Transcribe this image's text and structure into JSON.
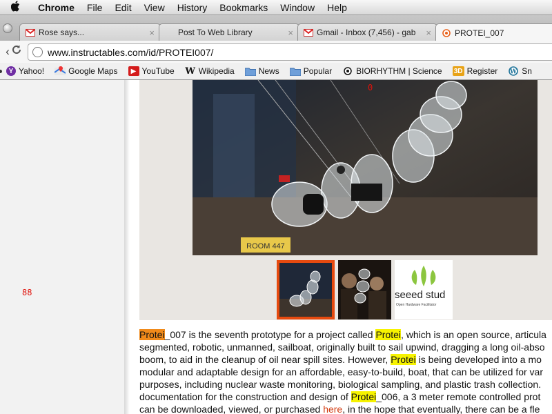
{
  "menubar": {
    "items": [
      "Chrome",
      "File",
      "Edit",
      "View",
      "History",
      "Bookmarks",
      "Window",
      "Help"
    ]
  },
  "tabs": [
    {
      "title": "Rose says...",
      "icon": "gmail-icon",
      "close": "×"
    },
    {
      "title": "Post To Web Library",
      "icon": "",
      "close": "×"
    },
    {
      "title": "Gmail - Inbox (7,456) - gab",
      "icon": "gmail-icon",
      "close": "×"
    },
    {
      "title": "PROTEI_007",
      "icon": "instructables-icon",
      "close": ""
    }
  ],
  "toolbar": {
    "url": "www.instructables.com/id/PROTEI007/"
  },
  "bookmarks": [
    {
      "label": "Yahoo!",
      "icon": "yahoo-icon"
    },
    {
      "label": "Google Maps",
      "icon": "google-maps-icon"
    },
    {
      "label": "YouTube",
      "icon": "youtube-icon"
    },
    {
      "label": "Wikipedia",
      "icon": "wikipedia-icon"
    },
    {
      "label": "News",
      "icon": "folder-icon"
    },
    {
      "label": "Popular",
      "icon": "folder-icon"
    },
    {
      "label": "BIORHYTHM | Science",
      "icon": "biorhythm-icon"
    },
    {
      "label": "Register",
      "icon": "3d-icon"
    },
    {
      "label": "Sn",
      "icon": "wordpress-icon"
    }
  ],
  "page": {
    "gutter_number": "88",
    "photo_number": "0",
    "thumb3_brand": "seeed stud",
    "thumb3_tagline": "Open Hardware Facilitator",
    "photo_sign": "ROOM 447",
    "article": {
      "l1_a": "Protei",
      "l1_b": "_007 is the seventh prototype for a project called ",
      "l1_c": "Protei",
      "l1_d": ", which is an open source, articula",
      "l2": "segmented, robotic, unmanned, sailboat, originally built to sail upwind, dragging a long oil-abso",
      "l3_a": "boom, to aid in the cleanup of oil near spill sites.  However, ",
      "l3_b": "Protei",
      "l3_c": " is being developed into a mo",
      "l4": "modular and adaptable design for an affordable, easy-to-build, boat, that can be utilized for var",
      "l5": "purposes, including nuclear waste monitoring, biological sampling, and plastic trash collection.",
      "l6_a": "documentation for the construction and design of ",
      "l6_b": "Protei",
      "l6_c": "_006, a 3 meter remote controlled prot",
      "l7_a": " can be downloaded, viewed, or purchased ",
      "l7_link": "here",
      "l7_c": ", in the hope that eventually, there can be a fle"
    }
  },
  "colors": {
    "highlight": "#f7f300",
    "highlight_first": "#f08a1a",
    "thumb_selected_border": "#e64a0f",
    "link": "#d23b10",
    "debug_number": "#e0120b"
  }
}
